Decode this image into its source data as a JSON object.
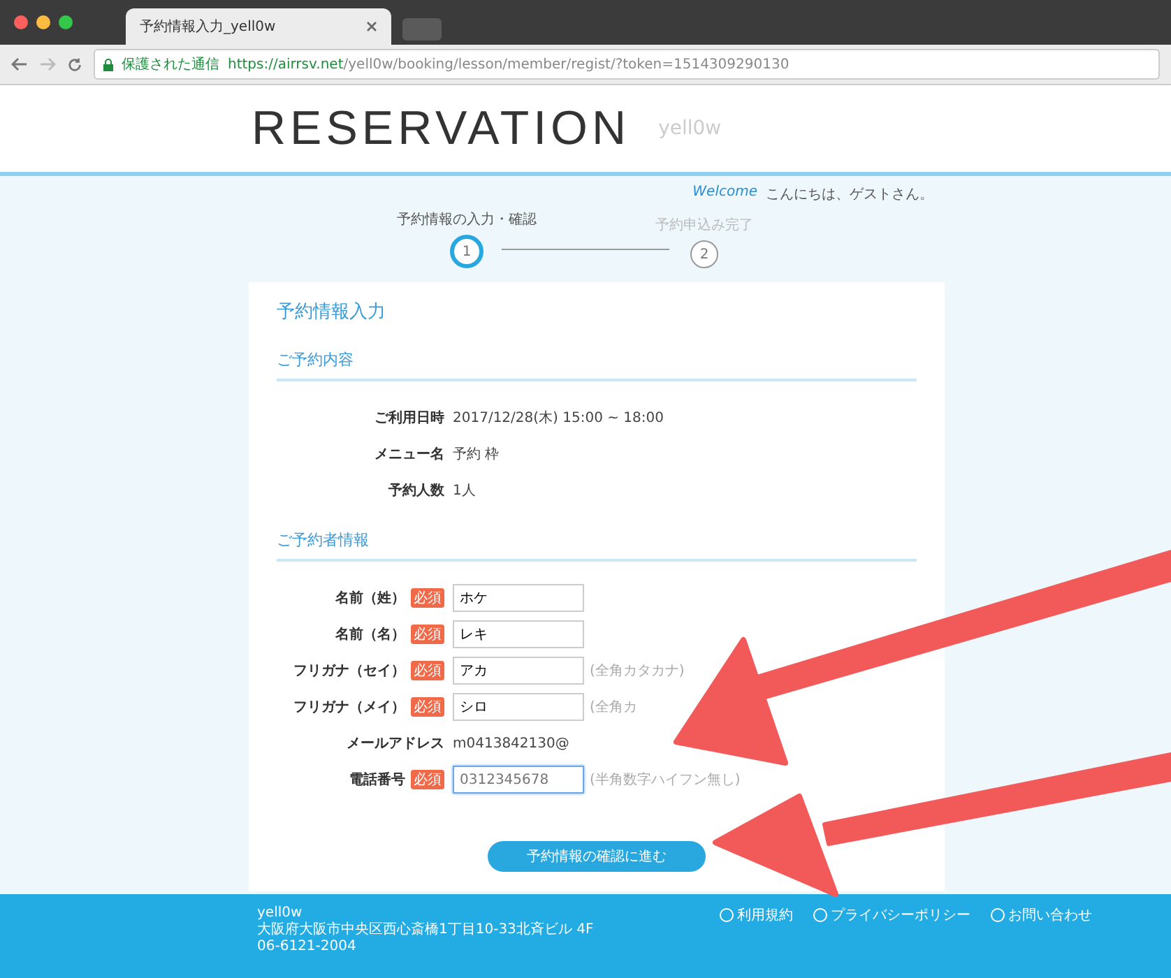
{
  "browser": {
    "tab_title": "予約情報入力_yell0w",
    "secure_label": "保護された通信",
    "url_host": "https://airrsv.net",
    "url_path": "/yell0w/booking/lesson/member/regist/?token=1514309290130"
  },
  "header": {
    "logo": "RESERVATION",
    "brand": "yell0w"
  },
  "welcome": {
    "label": "Welcome",
    "greeting": "こんにちは、ゲストさん。"
  },
  "steps": [
    {
      "number": "1",
      "label": "予約情報の入力・確認",
      "selected": true
    },
    {
      "number": "2",
      "label": "予約申込み完了",
      "selected": false
    }
  ],
  "card": {
    "title": "予約情報入力",
    "sections": [
      {
        "heading": "ご予約内容",
        "rows": [
          {
            "kind": "text",
            "label": "ご利用日時",
            "value": "2017/12/28(木) 15:00 ~ 18:00"
          },
          {
            "kind": "text",
            "label": "メニュー名",
            "value": "予約 枠"
          },
          {
            "kind": "text",
            "label": "予約人数",
            "value": "1人"
          }
        ]
      },
      {
        "heading": "ご予約者情報",
        "rows": [
          {
            "kind": "input",
            "label": "名前（姓）",
            "required": "必須",
            "value": "ホケ",
            "focused": false
          },
          {
            "kind": "input",
            "label": "名前（名）",
            "required": "必須",
            "value": "レキ",
            "focused": false
          },
          {
            "kind": "input",
            "label": "フリガナ（セイ）",
            "required": "必須",
            "value": "アカ",
            "hint": "(全角カタカナ)",
            "focused": false
          },
          {
            "kind": "input",
            "label": "フリガナ（メイ）",
            "required": "必須",
            "value": "シロ",
            "hint": "(全角カ",
            "focused": false
          },
          {
            "kind": "text",
            "label": "メールアドレス",
            "value": "m0413842130@"
          },
          {
            "kind": "input",
            "label": "電話番号",
            "required": "必須",
            "placeholder": "0312345678",
            "hint": "(半角数字ハイフン無し)",
            "focused": true
          }
        ]
      }
    ],
    "submit": "予約情報の確認に進む"
  },
  "footer": {
    "name": "yell0w",
    "address": "大阪府大阪市中央区西心斎橋1丁目10-33北斉ビル 4F",
    "phone": "06-6121-2004",
    "links": [
      "利用規約",
      "プライバシーポリシー",
      "お問い合わせ"
    ]
  }
}
